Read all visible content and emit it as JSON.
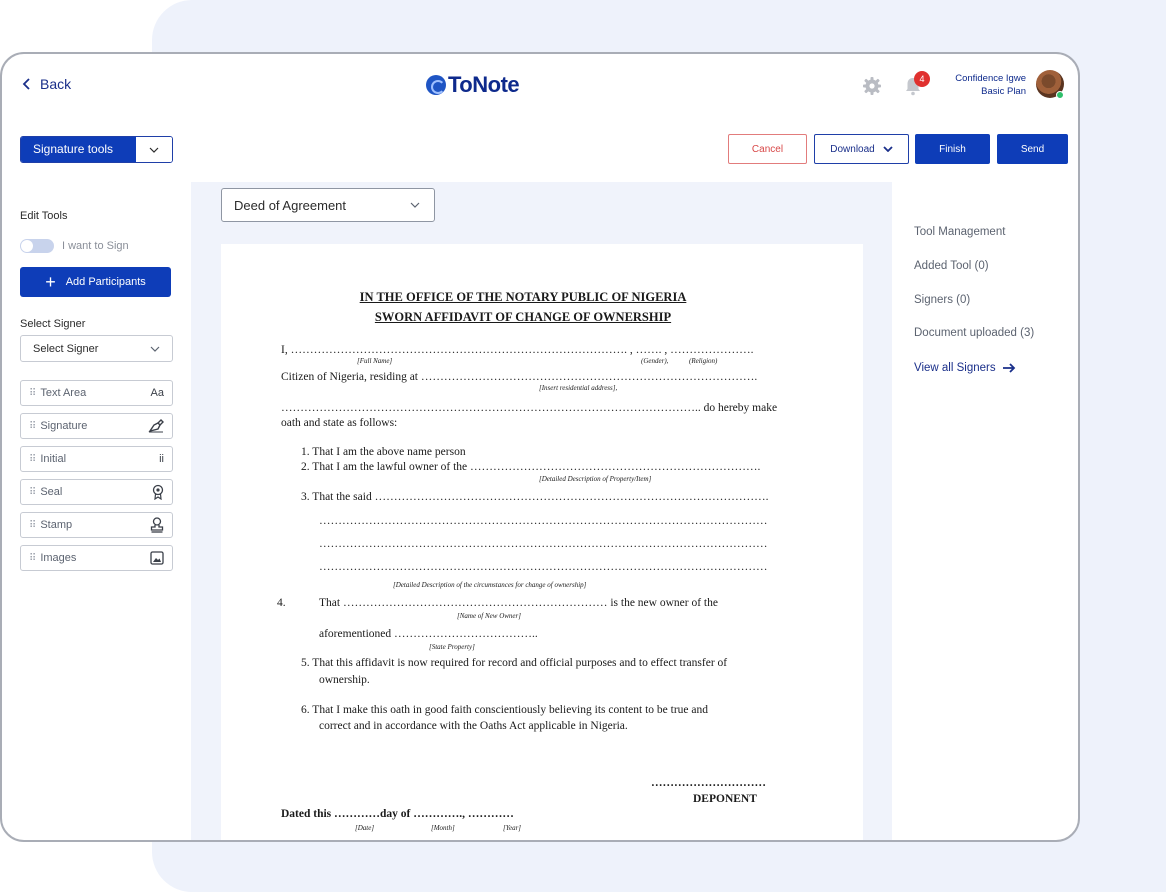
{
  "header": {
    "back_label": "Back",
    "logo_text": "ToNote",
    "notification_count": "4",
    "user_name": "Confidence Igwe",
    "user_plan": "Basic Plan"
  },
  "toolbar": {
    "signature_tools_label": "Signature tools",
    "cancel_label": "Cancel",
    "download_label": "Download",
    "finish_label": "Finish",
    "send_label": "Send"
  },
  "left_panel": {
    "edit_tools_label": "Edit Tools",
    "toggle_label": "I want to Sign",
    "add_participants_label": "Add Participants",
    "select_signer_label": "Select Signer",
    "select_signer_value": "Select Signer",
    "tools": [
      {
        "label": "Text Area",
        "icon": "text-aa-icon",
        "glyph": "Aa"
      },
      {
        "label": "Signature",
        "icon": "pen-nib-icon",
        "glyph": ""
      },
      {
        "label": "Initial",
        "icon": "initial-icon",
        "glyph": "ii"
      },
      {
        "label": "Seal",
        "icon": "seal-icon",
        "glyph": ""
      },
      {
        "label": "Stamp",
        "icon": "stamp-icon",
        "glyph": ""
      },
      {
        "label": "Images",
        "icon": "image-icon",
        "glyph": ""
      }
    ]
  },
  "document": {
    "template_select": "Deed of Agreement",
    "title1": "IN THE OFFICE OF THE NOTARY PUBLIC OF NIGERIA",
    "title2": "SWORN AFFIDAVIT OF CHANGE OF OWNERSHIP",
    "line_I": "I, ……………………………………………………………………………. , ……. , ………………….",
    "hint_fullname": "[Full Name]",
    "hint_gender": "(Gender),",
    "hint_religion": "(Religion)",
    "line_citizen": "Citizen of Nigeria, residing at …………………………………………………………………………….",
    "hint_address": "[Insert residential address],",
    "line_dots_hereby": "……………………………………………………………………………………………….. do hereby make",
    "line_oath": "oath and state as follows:",
    "item1": "1.  That I am the above name person",
    "item2": "2.  That I am the lawful owner of the ………………………………………………………………….",
    "hint_property": "[Detailed Description of Property/Item]",
    "item3": "3.  That the said ………………………………………………………………………………………….",
    "dots_line": "………………………………………………………………………………………………………",
    "hint_circumstances": "[Detailed Description of the circumstances for change of ownership]",
    "item4_num": "4.",
    "item4": "That …………………………………………………………… is the new owner of the",
    "hint_new_owner": "[Name of New Owner]",
    "item4b": "aforementioned ………………………………..",
    "hint_state_property": "[State Property]",
    "item5a": "5.  That this affidavit is now required for record and official purposes and to effect transfer of",
    "item5b": "ownership.",
    "item6a": "6.  That I make this oath in good faith conscientiously believing its content to be true and",
    "item6b": "correct and in accordance with the Oaths Act applicable in Nigeria.",
    "deponent_dots": "…………………………",
    "deponent": "DEPONENT",
    "dated": "Dated this …………day of …………., …………",
    "hint_date": "[Date]",
    "hint_month": "[Month]",
    "hint_year": "[Year]"
  },
  "right_panel": {
    "tool_management": "Tool Management",
    "added_tool": "Added Tool (0)",
    "signers": "Signers (0)",
    "document_uploaded": "Document uploaded (3)",
    "view_all_signers": "View all Signers"
  },
  "colors": {
    "primary": "#0e3db8",
    "cancel_border": "#e27c7c",
    "badge": "#e0312f",
    "panel_bg": "#eef2fb"
  }
}
